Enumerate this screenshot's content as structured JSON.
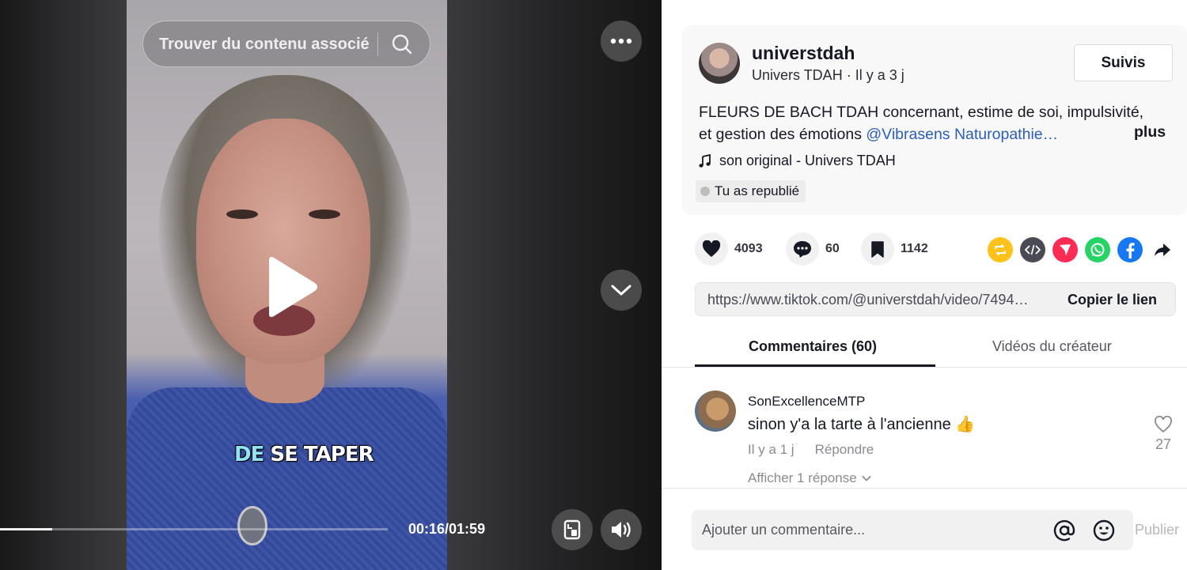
{
  "video": {
    "search_placeholder": "Trouver du contenu associé",
    "caption_highlight": "DE",
    "caption_rest": " SE TAPER",
    "time": "00:16/01:59",
    "progress_fraction": 0.134
  },
  "post": {
    "username": "universtdah",
    "display_name": "Univers TDAH",
    "age": "Il y a 3 j",
    "follow_label": "Suivis",
    "description": "FLEURS DE BACH TDAH concernant, estime de soi, impulsivité, et gestion des émotions ",
    "mention": "@Vibrasens Naturopathie…",
    "more_label": "plus",
    "music": "son original - Univers TDAH",
    "repost_label": "Tu as republié"
  },
  "actions": {
    "likes": "4093",
    "comments": "60",
    "saves": "1142"
  },
  "share": {
    "url": "https://www.tiktok.com/@universtdah/video/7494…",
    "copy_label": "Copier le lien"
  },
  "tabs": {
    "comments": "Commentaires (60)",
    "creator_videos": "Vidéos du créateur"
  },
  "comments": [
    {
      "user": "SonExcellenceMTP",
      "text": "sinon y'a la tarte à l'ancienne 👍",
      "age": "Il y a 1 j",
      "reply_label": "Répondre",
      "likes": "27",
      "view_replies": "Afficher 1 réponse"
    }
  ],
  "footer": {
    "placeholder": "Ajouter un commentaire...",
    "publish_label": "Publier"
  },
  "colors": {
    "mention": "#2b5db9",
    "repost": "#ffc21a",
    "embed": "#4a4a55",
    "friends": "#fe2c55",
    "whatsapp": "#25d366",
    "facebook": "#1877f2"
  },
  "icons": [
    "search-icon",
    "more-icon",
    "play-icon",
    "chevron-down-icon",
    "pip-icon",
    "volume-icon",
    "music-note-icon",
    "heart-icon",
    "comment-icon",
    "bookmark-icon",
    "repost-icon",
    "embed-icon",
    "send-icon",
    "whatsapp-icon",
    "facebook-icon",
    "share-arrow-icon",
    "at-icon",
    "emoji-icon"
  ]
}
